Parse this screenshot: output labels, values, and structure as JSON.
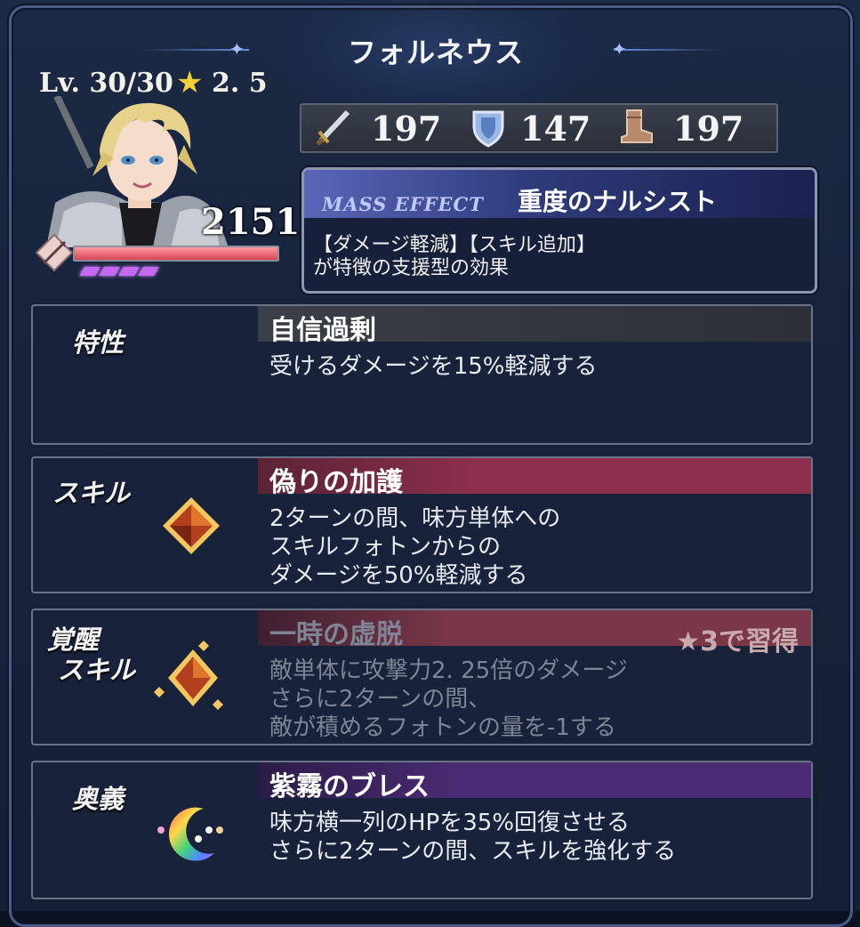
{
  "header": {
    "title": "フォルネウス"
  },
  "character": {
    "level": "Lv. 30/30",
    "rarity": "2. 5",
    "hp": "2151",
    "hp_fill": 1.0,
    "gauge_pips": 4
  },
  "stats": {
    "attack": "197",
    "defense": "147",
    "speed": "197"
  },
  "mass_effect": {
    "tag": "MASS EFFECT",
    "name": "重度のナルシスト",
    "description_line1": "【ダメージ軽減】【スキル追加】",
    "description_line2": "が特徴の支援型の効果"
  },
  "trait": {
    "label": "特性",
    "name": "自信過剰",
    "description": "受けるダメージを15%軽減する"
  },
  "skill": {
    "label": "スキル",
    "name": "偽りの加護",
    "lines": [
      "2ターンの間、味方単体への",
      "スキルフォトンからの",
      "ダメージを50%軽減する"
    ]
  },
  "awakening": {
    "label_line1": "覚醒",
    "label_line2": "スキル",
    "name": "一時の虚脱",
    "lock_note": "★3で習得",
    "lines": [
      "敵単体に攻撃力2. 25倍のダメージ",
      "さらに2ターンの間、",
      "敵が積めるフォトンの量を-1する"
    ]
  },
  "ultimate": {
    "label": "奥義",
    "name": "紫霧のブレス",
    "lines": [
      "味方横一列のHPを35%回復させる",
      "さらに2ターンの間、スキルを強化する"
    ]
  },
  "colors": {
    "skill_header": "#8d2f4c",
    "awakening_header": "#7a3748",
    "ultimate_header": "#4a2a72",
    "trait_header": "#2c3038",
    "accent_gold": "#f5cf3a",
    "gauge": "#c56af0"
  },
  "icons": {
    "weapon": "spear-icon",
    "attack": "sword-icon",
    "defense": "shield-icon",
    "speed": "boot-icon",
    "skill": "diamond-gem-icon",
    "awakening": "diamond-gem-cluster-icon",
    "ultimate": "crescent-moon-icon"
  }
}
